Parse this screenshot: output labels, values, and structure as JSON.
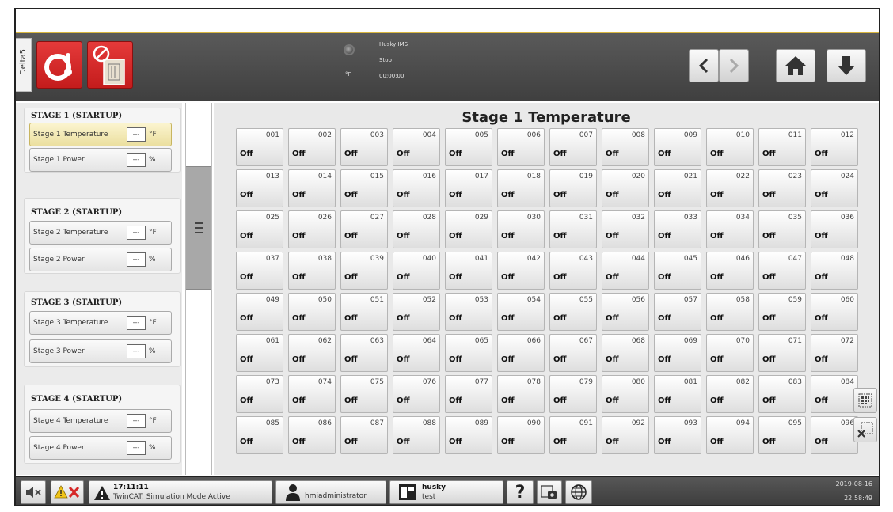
{
  "header": {
    "side_tab": "Delta5",
    "status": {
      "unit": "°F",
      "machine": "Husky IMS",
      "state": "Stop",
      "cycle_time": "00:00:00"
    }
  },
  "left_panel": {
    "stages": [
      {
        "title": "STAGE 1 (STARTUP)",
        "temp_label": "Stage 1 Temperature",
        "temp_value": "---",
        "temp_unit": "°F",
        "power_label": "Stage 1 Power",
        "power_value": "---",
        "power_unit": "%"
      },
      {
        "title": "STAGE 2 (STARTUP)",
        "temp_label": "Stage 2 Temperature",
        "temp_value": "---",
        "temp_unit": "°F",
        "power_label": "Stage 2 Power",
        "power_value": "---",
        "power_unit": "%"
      },
      {
        "title": "STAGE 3 (STARTUP)",
        "temp_label": "Stage 3 Temperature",
        "temp_value": "---",
        "temp_unit": "°F",
        "power_label": "Stage 3 Power",
        "power_value": "---",
        "power_unit": "%"
      },
      {
        "title": "STAGE 4 (STARTUP)",
        "temp_label": "Stage 4 Temperature",
        "temp_value": "---",
        "temp_unit": "°F",
        "power_label": "Stage 4 Power",
        "power_value": "---",
        "power_unit": "%"
      }
    ],
    "active": "Stage 1 Temperature"
  },
  "main": {
    "title": "Stage 1 Temperature",
    "zones": [
      {
        "num": "001",
        "value": "Off"
      },
      {
        "num": "002",
        "value": "Off"
      },
      {
        "num": "003",
        "value": "Off"
      },
      {
        "num": "004",
        "value": "Off"
      },
      {
        "num": "005",
        "value": "Off"
      },
      {
        "num": "006",
        "value": "Off"
      },
      {
        "num": "007",
        "value": "Off"
      },
      {
        "num": "008",
        "value": "Off"
      },
      {
        "num": "009",
        "value": "Off"
      },
      {
        "num": "010",
        "value": "Off"
      },
      {
        "num": "011",
        "value": "Off"
      },
      {
        "num": "012",
        "value": "Off"
      },
      {
        "num": "013",
        "value": "Off"
      },
      {
        "num": "014",
        "value": "Off"
      },
      {
        "num": "015",
        "value": "Off"
      },
      {
        "num": "016",
        "value": "Off"
      },
      {
        "num": "017",
        "value": "Off"
      },
      {
        "num": "018",
        "value": "Off"
      },
      {
        "num": "019",
        "value": "Off"
      },
      {
        "num": "020",
        "value": "Off"
      },
      {
        "num": "021",
        "value": "Off"
      },
      {
        "num": "022",
        "value": "Off"
      },
      {
        "num": "023",
        "value": "Off"
      },
      {
        "num": "024",
        "value": "Off"
      },
      {
        "num": "025",
        "value": "Off"
      },
      {
        "num": "026",
        "value": "Off"
      },
      {
        "num": "027",
        "value": "Off"
      },
      {
        "num": "028",
        "value": "Off"
      },
      {
        "num": "029",
        "value": "Off"
      },
      {
        "num": "030",
        "value": "Off"
      },
      {
        "num": "031",
        "value": "Off"
      },
      {
        "num": "032",
        "value": "Off"
      },
      {
        "num": "033",
        "value": "Off"
      },
      {
        "num": "034",
        "value": "Off"
      },
      {
        "num": "035",
        "value": "Off"
      },
      {
        "num": "036",
        "value": "Off"
      },
      {
        "num": "037",
        "value": "Off"
      },
      {
        "num": "038",
        "value": "Off"
      },
      {
        "num": "039",
        "value": "Off"
      },
      {
        "num": "040",
        "value": "Off"
      },
      {
        "num": "041",
        "value": "Off"
      },
      {
        "num": "042",
        "value": "Off"
      },
      {
        "num": "043",
        "value": "Off"
      },
      {
        "num": "044",
        "value": "Off"
      },
      {
        "num": "045",
        "value": "Off"
      },
      {
        "num": "046",
        "value": "Off"
      },
      {
        "num": "047",
        "value": "Off"
      },
      {
        "num": "048",
        "value": "Off"
      },
      {
        "num": "049",
        "value": "Off"
      },
      {
        "num": "050",
        "value": "Off"
      },
      {
        "num": "051",
        "value": "Off"
      },
      {
        "num": "052",
        "value": "Off"
      },
      {
        "num": "053",
        "value": "Off"
      },
      {
        "num": "054",
        "value": "Off"
      },
      {
        "num": "055",
        "value": "Off"
      },
      {
        "num": "056",
        "value": "Off"
      },
      {
        "num": "057",
        "value": "Off"
      },
      {
        "num": "058",
        "value": "Off"
      },
      {
        "num": "059",
        "value": "Off"
      },
      {
        "num": "060",
        "value": "Off"
      },
      {
        "num": "061",
        "value": "Off"
      },
      {
        "num": "062",
        "value": "Off"
      },
      {
        "num": "063",
        "value": "Off"
      },
      {
        "num": "064",
        "value": "Off"
      },
      {
        "num": "065",
        "value": "Off"
      },
      {
        "num": "066",
        "value": "Off"
      },
      {
        "num": "067",
        "value": "Off"
      },
      {
        "num": "068",
        "value": "Off"
      },
      {
        "num": "069",
        "value": "Off"
      },
      {
        "num": "070",
        "value": "Off"
      },
      {
        "num": "071",
        "value": "Off"
      },
      {
        "num": "072",
        "value": "Off"
      },
      {
        "num": "073",
        "value": "Off"
      },
      {
        "num": "074",
        "value": "Off"
      },
      {
        "num": "075",
        "value": "Off"
      },
      {
        "num": "076",
        "value": "Off"
      },
      {
        "num": "077",
        "value": "Off"
      },
      {
        "num": "078",
        "value": "Off"
      },
      {
        "num": "079",
        "value": "Off"
      },
      {
        "num": "080",
        "value": "Off"
      },
      {
        "num": "081",
        "value": "Off"
      },
      {
        "num": "082",
        "value": "Off"
      },
      {
        "num": "083",
        "value": "Off"
      },
      {
        "num": "084",
        "value": "Off"
      },
      {
        "num": "085",
        "value": "Off"
      },
      {
        "num": "086",
        "value": "Off"
      },
      {
        "num": "087",
        "value": "Off"
      },
      {
        "num": "088",
        "value": "Off"
      },
      {
        "num": "089",
        "value": "Off"
      },
      {
        "num": "090",
        "value": "Off"
      },
      {
        "num": "091",
        "value": "Off"
      },
      {
        "num": "092",
        "value": "Off"
      },
      {
        "num": "093",
        "value": "Off"
      },
      {
        "num": "094",
        "value": "Off"
      },
      {
        "num": "095",
        "value": "Off"
      },
      {
        "num": "096",
        "value": "Off"
      }
    ]
  },
  "footer": {
    "alarm_time": "17:11:11",
    "alarm_text": "TwinCAT: Simulation Mode Active",
    "user": "hmiadministrator",
    "machine_name": "husky",
    "machine_sub": "test",
    "help_glyph": "?",
    "date": "2019-08-16",
    "time": "22:58:49"
  },
  "icons": {
    "alarm": "alarm-thermometer-icon",
    "heater": "heater-disabled-icon",
    "back": "chevron-left-icon",
    "forward": "chevron-right-icon",
    "home": "home-icon",
    "down": "arrow-down-icon",
    "mute": "speaker-mute-icon",
    "ack": "warning-clear-icon",
    "warn": "warning-triangle-icon",
    "user": "user-icon",
    "machine": "machine-icon",
    "screenshot": "screenshot-icon",
    "language": "globe-icon",
    "select_all": "select-all-icon",
    "clear_selection": "clear-selection-icon"
  },
  "colors": {
    "alarm_red": "#d62828",
    "active_highlight": "#f3e9b5",
    "bar_dark": "#4a4a4a",
    "accent_gold": "#d9b740"
  }
}
